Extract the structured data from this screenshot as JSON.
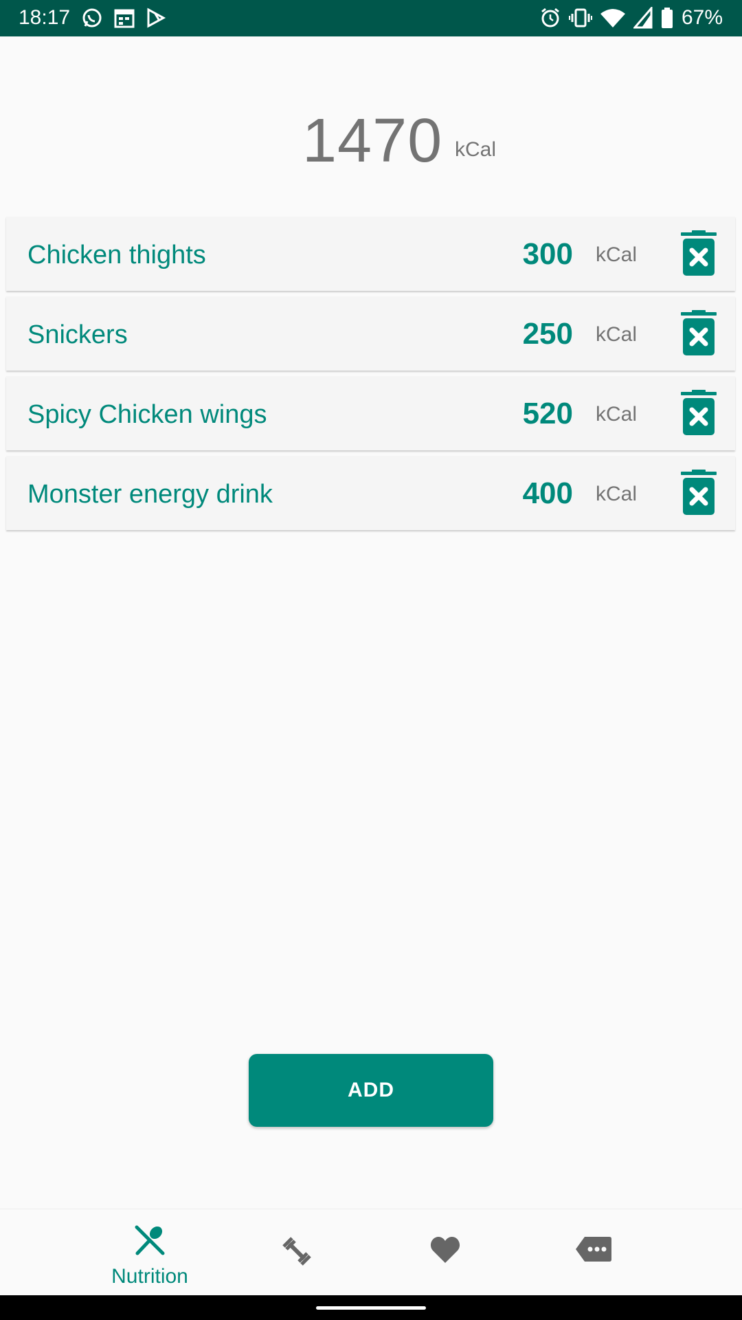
{
  "status_bar": {
    "time": "18:17",
    "battery": "67%",
    "left_icons": [
      "whatsapp-icon",
      "calendar-icon",
      "play-store-icon"
    ],
    "right_icons": [
      "alarm-icon",
      "vibrate-icon",
      "wifi-icon",
      "signal-icon",
      "battery-icon"
    ]
  },
  "total": {
    "value": "1470",
    "unit": "kCal"
  },
  "foods": [
    {
      "name": "Chicken thights",
      "kcal": "300",
      "unit": "kCal"
    },
    {
      "name": "Snickers",
      "kcal": "250",
      "unit": "kCal"
    },
    {
      "name": "Spicy Chicken wings",
      "kcal": "520",
      "unit": "kCal"
    },
    {
      "name": "Monster energy drink",
      "kcal": "400",
      "unit": "kCal"
    }
  ],
  "actions": {
    "add_label": "ADD"
  },
  "bottom_nav": {
    "items": [
      {
        "label": "Nutrition",
        "icon": "nutrition-icon",
        "active": true
      },
      {
        "label": "",
        "icon": "fitness-icon",
        "active": false
      },
      {
        "label": "",
        "icon": "heart-icon",
        "active": false
      },
      {
        "label": "",
        "icon": "more-tag-icon",
        "active": false
      }
    ]
  },
  "colors": {
    "accent": "#00897b",
    "status_bar": "#00574b",
    "muted_text": "#737373",
    "inactive_icon": "#666666"
  }
}
